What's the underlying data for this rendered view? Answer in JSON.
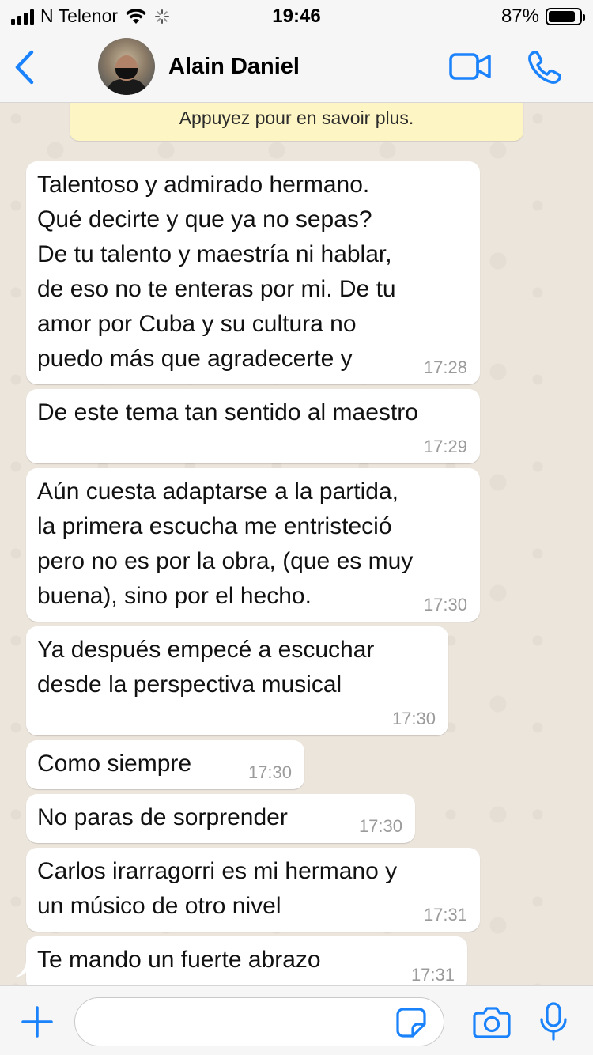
{
  "status_bar": {
    "carrier": "N Telenor",
    "time": "19:46",
    "battery_percent": "87%",
    "battery_level": 0.87,
    "signal_bars": 4
  },
  "header": {
    "contact_name": "Alain Daniel",
    "icons": [
      "chevron-left-icon",
      "avatar",
      "video-camera-icon",
      "phone-icon"
    ]
  },
  "notice": {
    "text": "Appuyez pour en savoir plus."
  },
  "messages": [
    {
      "text": "Talentoso y admirado hermano.\nQué decirte y que ya no sepas?\nDe tu talento y maestría ni hablar,\nde eso no te enteras por mi. De tu\namor por Cuba y su cultura no\npuedo más que agradecerte y",
      "time": "17:28"
    },
    {
      "text": "De este tema tan sentido al maestro",
      "time": "17:29"
    },
    {
      "text": "Aún cuesta adaptarse a la partida,\nla primera escucha me entristeció\npero no es por la obra, (que es muy\nbuena), sino por el hecho.",
      "time": "17:30"
    },
    {
      "text": "Ya después empecé a escuchar\ndesde la perspectiva musical",
      "time": "17:30"
    },
    {
      "text": "Como siempre",
      "time": "17:30"
    },
    {
      "text": "No paras de sorprender",
      "time": "17:30"
    },
    {
      "text": "Carlos irarragorri es mi hermano y\nun músico de otro nivel",
      "time": "17:31"
    },
    {
      "text": "Te mando un fuerte abrazo",
      "time": "17:31"
    }
  ],
  "input": {
    "value": "",
    "placeholder": ""
  },
  "colors": {
    "accent": "#1a82fb",
    "bubble_incoming": "#ffffff",
    "chat_background": "#ece5dc",
    "notice_background": "#fdf5c4"
  }
}
